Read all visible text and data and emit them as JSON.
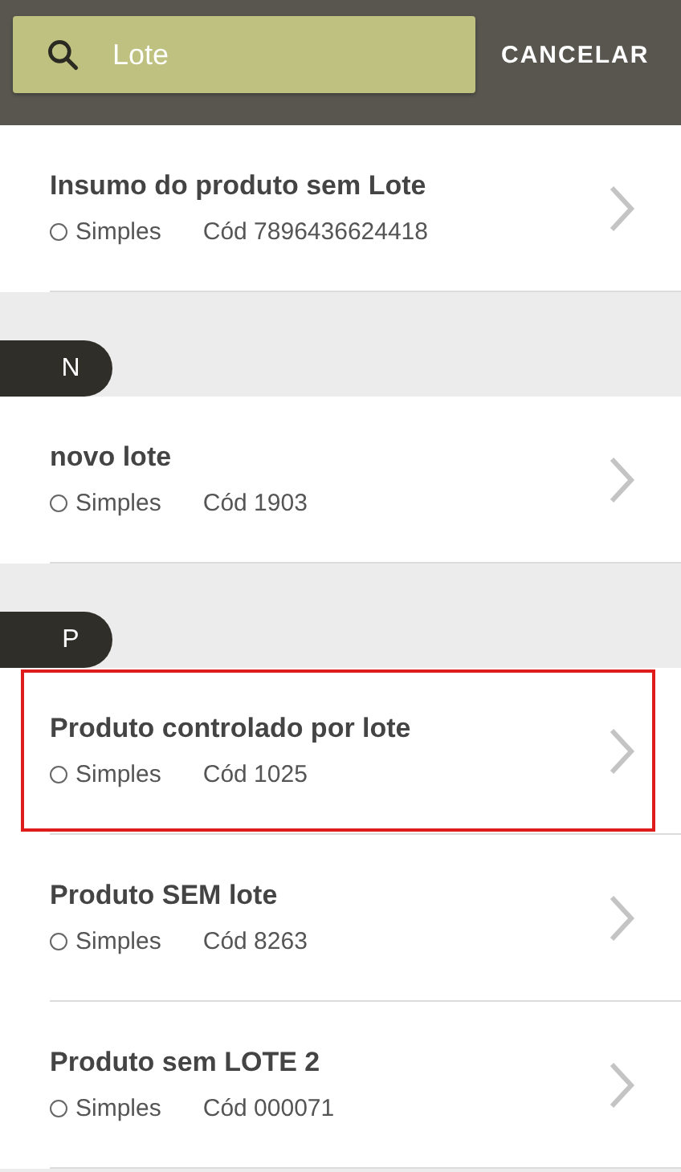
{
  "search": {
    "value": "Lote"
  },
  "cancel_button": "CANCELAR",
  "groups": [
    {
      "items": [
        {
          "title": "Insumo do produto sem Lote",
          "type": "Simples",
          "code": "Cód 7896436624418",
          "highlighted": false
        }
      ]
    },
    {
      "letter": "N",
      "items": [
        {
          "title": "novo lote",
          "type": "Simples",
          "code": "Cód 1903",
          "highlighted": false
        }
      ]
    },
    {
      "letter": "P",
      "items": [
        {
          "title": "Produto controlado por lote",
          "type": "Simples",
          "code": "Cód 1025",
          "highlighted": true
        },
        {
          "title": "Produto SEM lote",
          "type": "Simples",
          "code": "Cód 8263",
          "highlighted": false
        },
        {
          "title": "Produto sem LOTE 2",
          "type": "Simples",
          "code": "Cód 000071",
          "highlighted": false
        }
      ]
    }
  ]
}
